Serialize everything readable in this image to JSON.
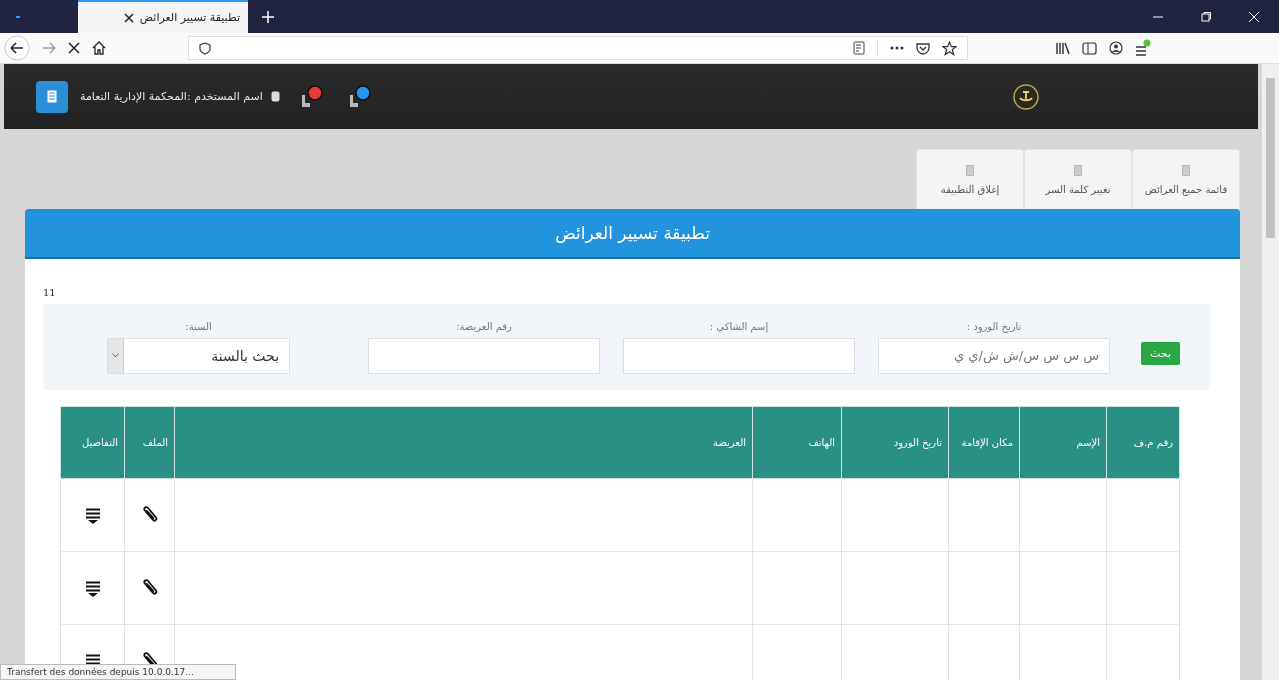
{
  "browser": {
    "tab_title": "تطبيقة تسيير العرائض",
    "status": "Transfert des données depuis 10.0.0.17..."
  },
  "header": {
    "user_label": "اسم المستخدم :المحكمة الإدارية النعامة",
    "notifications": [
      {
        "color": "#e8393a"
      },
      {
        "color": "#2196f3"
      }
    ]
  },
  "nav_tabs": [
    {
      "label": "قائمة جميع العرائض"
    },
    {
      "label": "تغيير كلمة السر"
    },
    {
      "label": "إغلاق التطبيقة"
    }
  ],
  "banner_title": "تطبيقة تسيير العرائض",
  "count": "11",
  "search": {
    "button": "بحث",
    "date": {
      "label": "تاريخ الورود :",
      "placeholder": "س س س س/ش ش/ي ي"
    },
    "complainant": {
      "label": "إسم الشاكي :"
    },
    "number": {
      "label": "رقم العريضة:"
    },
    "year": {
      "label": "السنة:",
      "value": "بحث بالسنة"
    }
  },
  "table": {
    "columns": [
      "رقم م.ف",
      "الإسم",
      "مكان الإقامة",
      "تاريخ الورود",
      "الهاتف",
      "العريضة",
      "الملف",
      "التفاصيل"
    ],
    "rows": [
      {
        "attachment": true,
        "details": true
      },
      {
        "attachment": true,
        "details": true
      },
      {
        "attachment": true,
        "details": true
      }
    ]
  }
}
